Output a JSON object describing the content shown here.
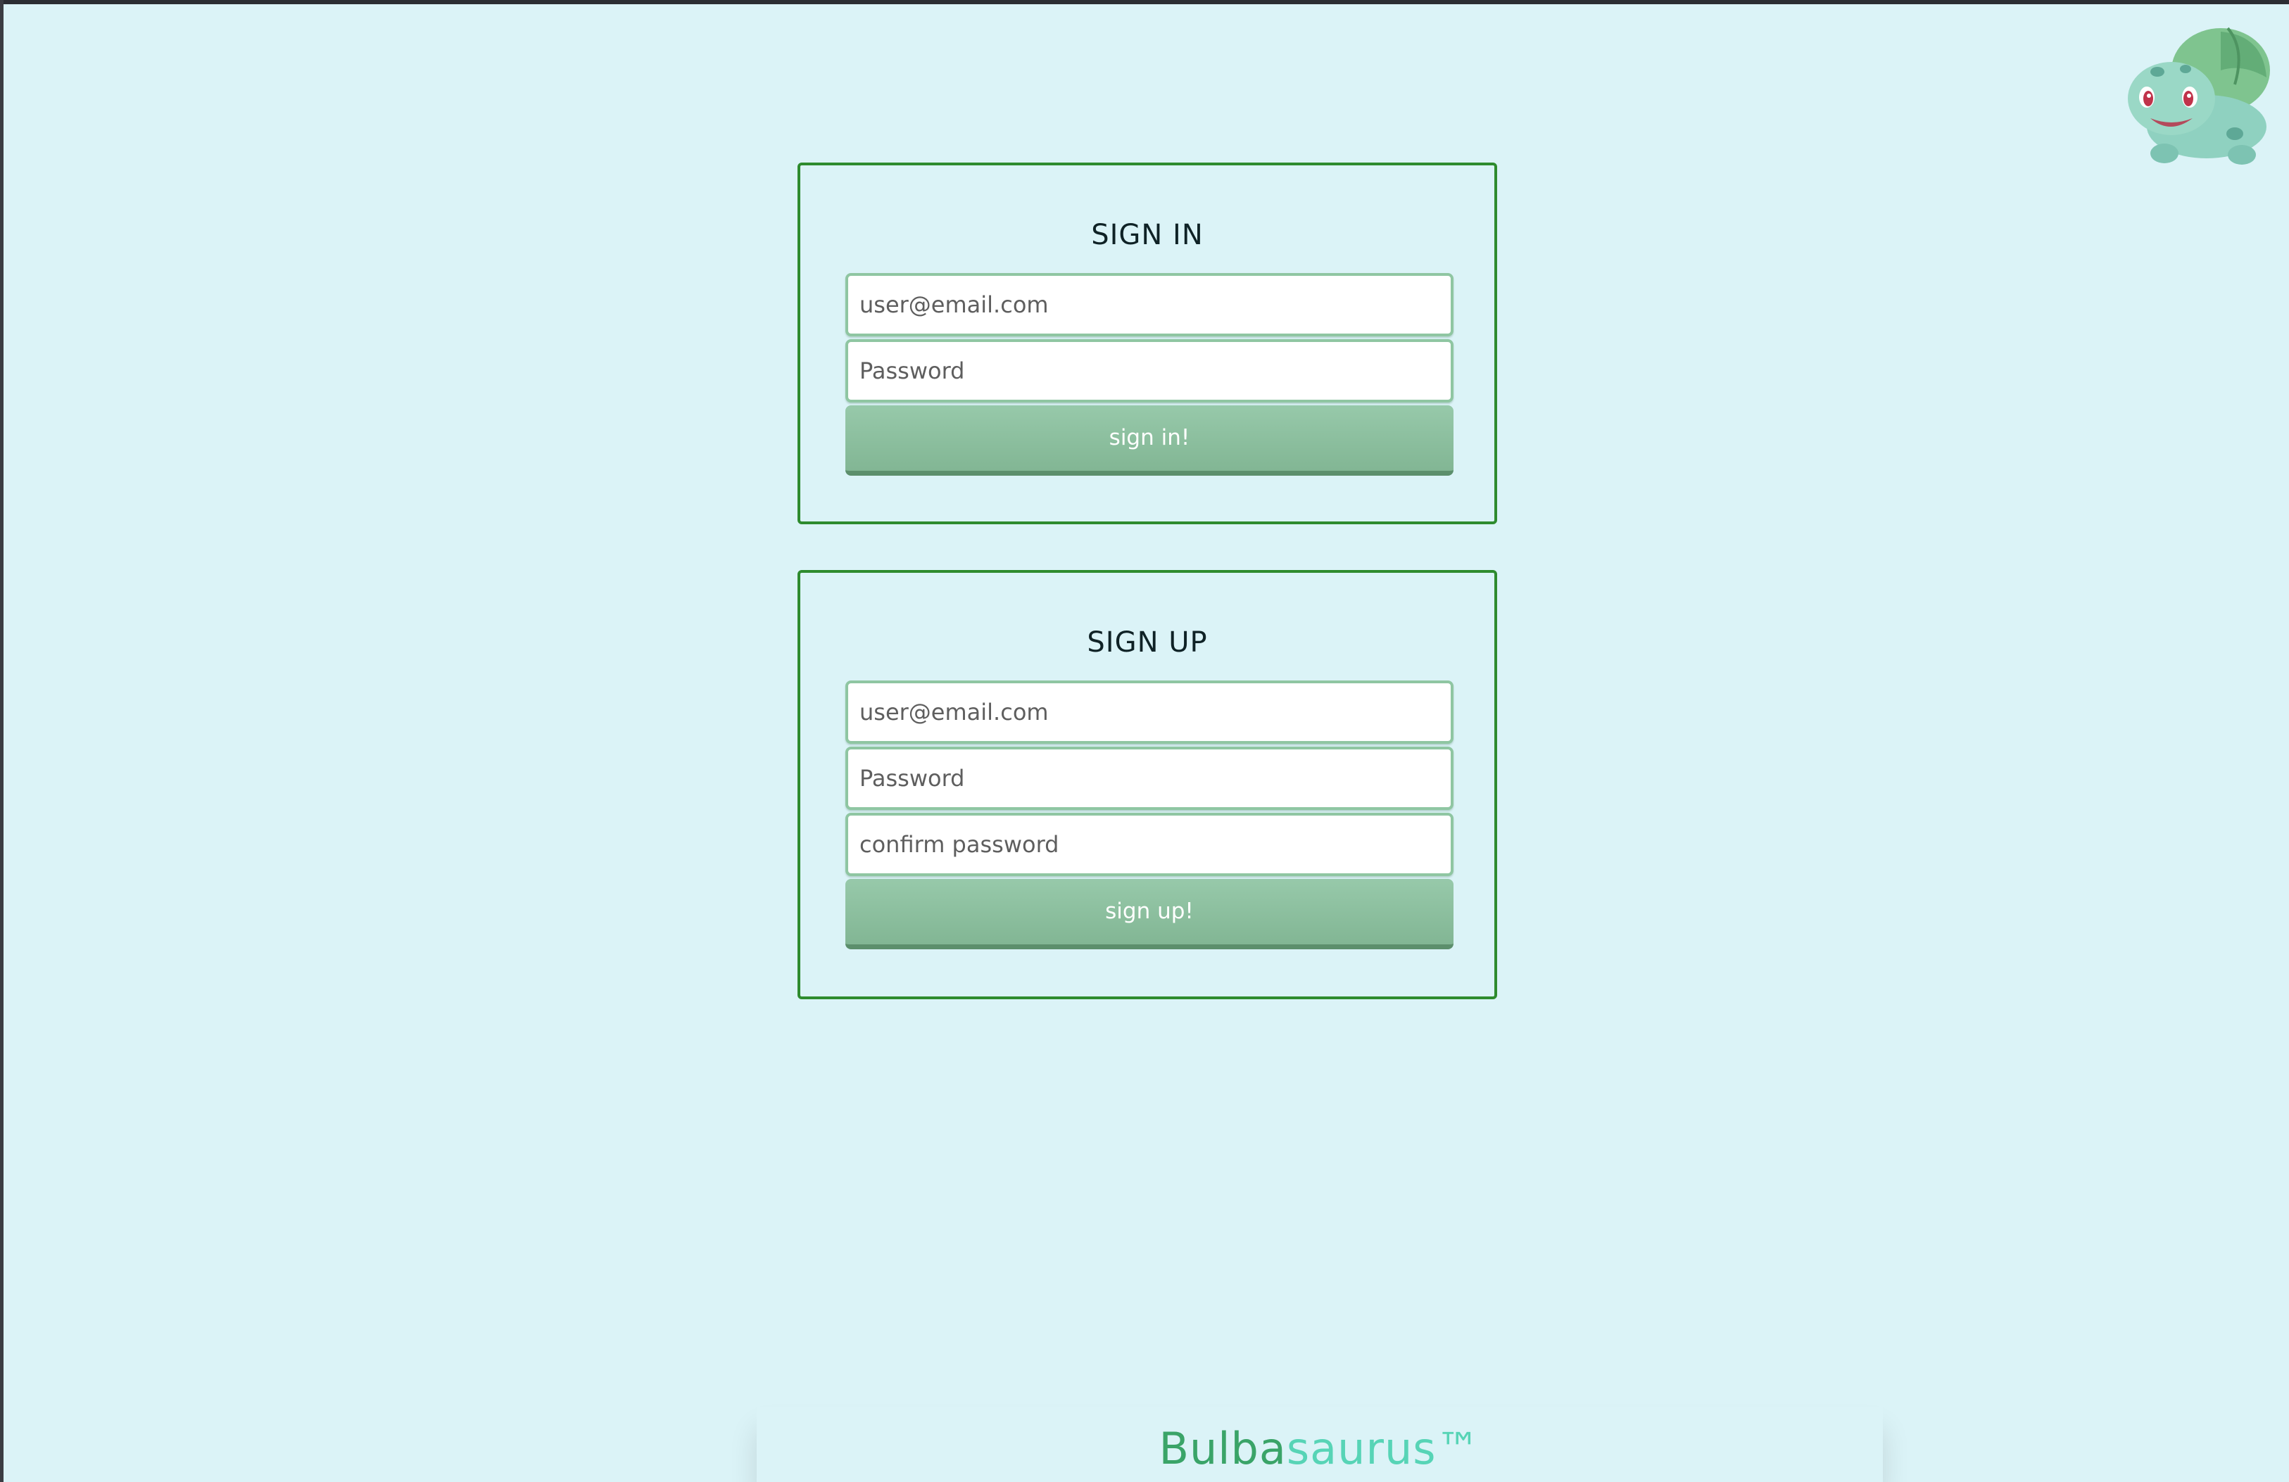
{
  "sign_in": {
    "title": "SIGN IN",
    "email_placeholder": "user@email.com",
    "password_placeholder": "Password",
    "button_label": "sign in!"
  },
  "sign_up": {
    "title": "SIGN UP",
    "email_placeholder": "user@email.com",
    "password_placeholder": "Password",
    "confirm_placeholder": "confirm password",
    "button_label": "sign up!"
  },
  "footer": {
    "brand_part1": "Bulba",
    "brand_part2": "saurus™"
  },
  "mascot": {
    "icon": "bulbasaur-icon"
  },
  "colors": {
    "background": "#dbf3f7",
    "card_border": "#2e8b2e",
    "button": "#8cc2a0",
    "brand_green": "#3aa468",
    "brand_teal": "#57d4b6"
  }
}
